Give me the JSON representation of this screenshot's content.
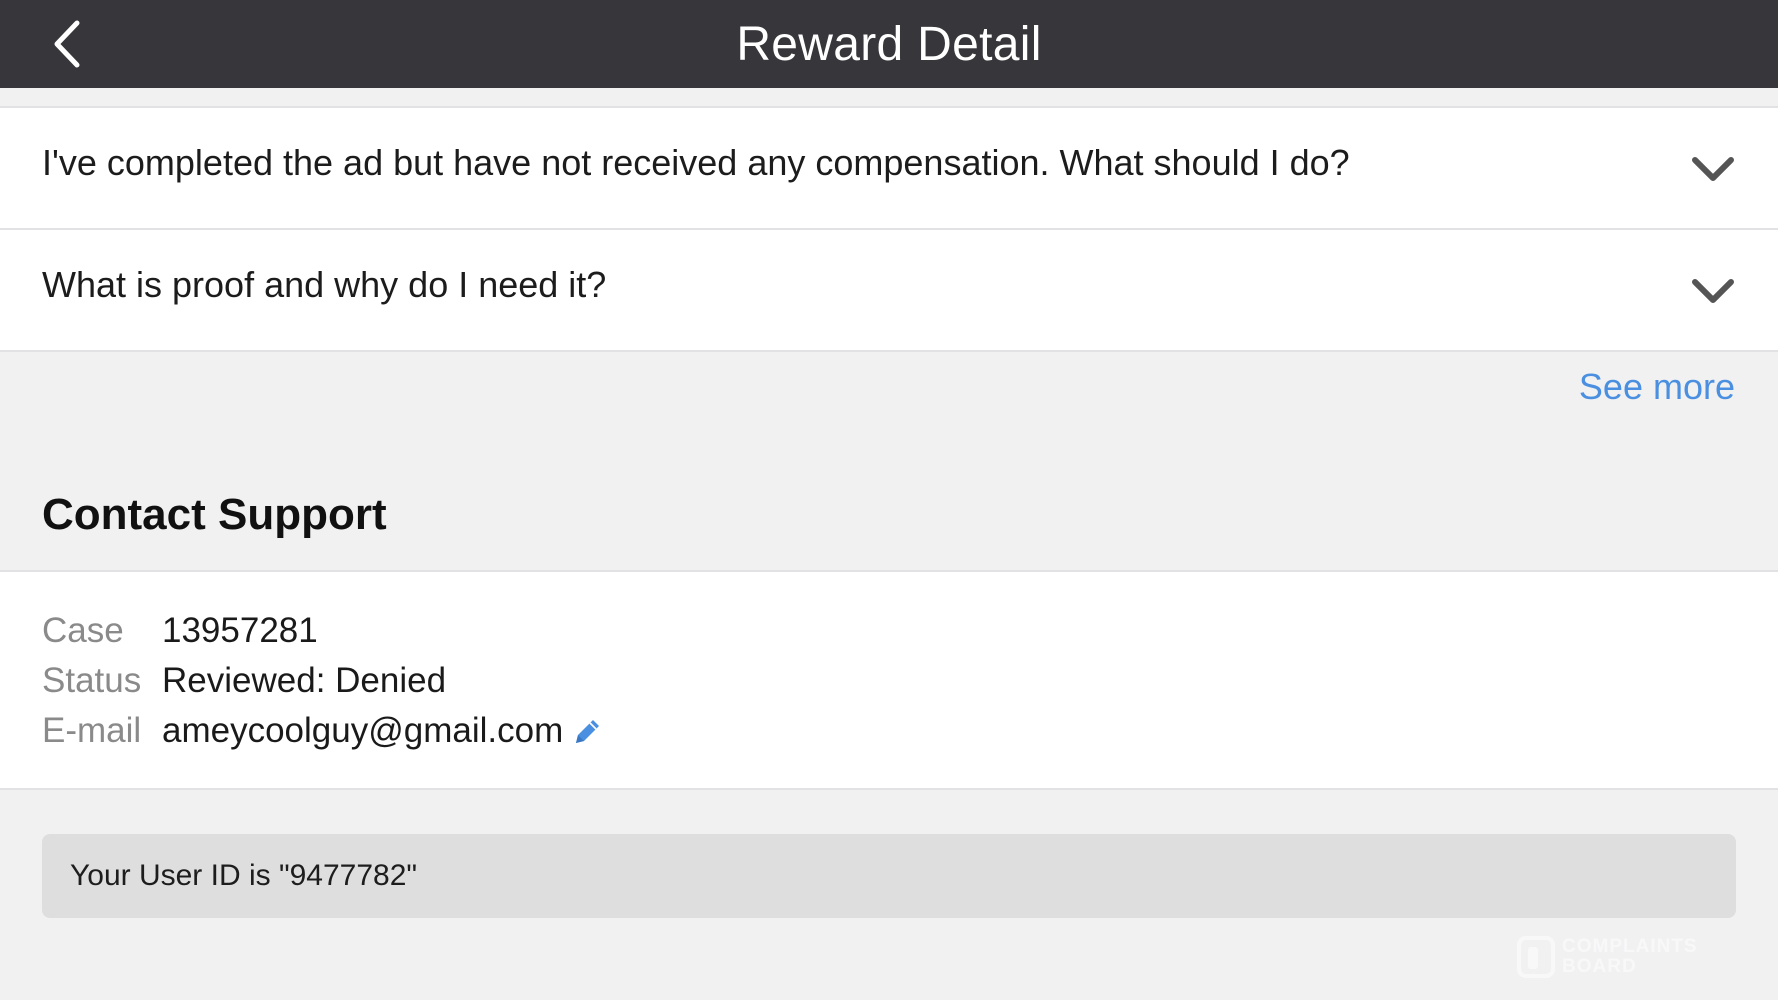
{
  "header": {
    "title": "Reward Detail",
    "back_icon": "chevron-left-icon"
  },
  "faq": {
    "items": [
      {
        "question": "I've completed the ad but have not received any compensation. What should I do?",
        "icon": "chevron-down-icon"
      },
      {
        "question": "What is proof and why do I need it?",
        "icon": "chevron-down-icon"
      }
    ],
    "see_more_label": "See more"
  },
  "contact_support": {
    "title": "Contact Support",
    "rows": [
      {
        "label": "Case",
        "value": "13957281"
      },
      {
        "label": "Status",
        "value": "Reviewed: Denied"
      },
      {
        "label": "E-mail",
        "value": "ameycoolguy@gmail.com",
        "icon": "pencil-icon"
      }
    ]
  },
  "user_id_text": "Your User ID is \"9477782\"",
  "watermark": {
    "line1": "COMPLAINTS",
    "line2": "BOARD"
  },
  "colors": {
    "header_bg": "#37363b",
    "link": "#4a8fe0",
    "page_bg": "#f1f1f2",
    "userid_bg": "#dedede"
  }
}
